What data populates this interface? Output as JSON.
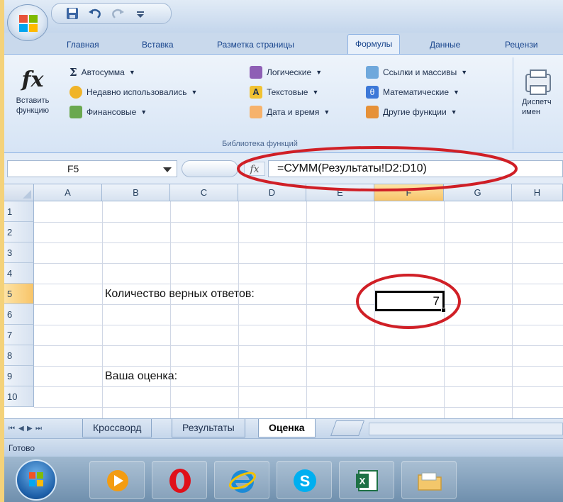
{
  "quick_access": {
    "save_icon": "save-icon",
    "undo_icon": "undo-icon",
    "redo_icon": "redo-icon",
    "customize_icon": "customize-arrow-icon"
  },
  "tabs": [
    "Главная",
    "Вставка",
    "Разметка страницы",
    "Формулы",
    "Данные",
    "Рецензи"
  ],
  "active_tab": "Формулы",
  "ribbon": {
    "insert_function": "Вставить функцию",
    "autosum": "Автосумма",
    "recent": "Недавно использовались",
    "financial": "Финансовые",
    "logical": "Логические",
    "text": "Текстовые",
    "datetime": "Дата и время",
    "lookup": "Ссылки и массивы",
    "math": "Математические",
    "more": "Другие функции",
    "group_label": "Библиотека функций",
    "name_manager": "Диспетч имен"
  },
  "formula_bar": {
    "name_box": "F5",
    "fx": "fx",
    "formula": "=СУММ(Результаты!D2:D10)"
  },
  "columns": [
    "A",
    "B",
    "C",
    "D",
    "E",
    "F",
    "G",
    "H"
  ],
  "rows": [
    "1",
    "2",
    "3",
    "4",
    "5",
    "6",
    "7",
    "8",
    "9",
    "10"
  ],
  "cells": {
    "B5": "Количество верных ответов:",
    "F5": "7",
    "B9": "Ваша оценка:"
  },
  "sheet_nav": [
    "⏮",
    "◀",
    "▶",
    "⏭"
  ],
  "sheets": [
    "Кроссворд",
    "Результаты",
    "Оценка"
  ],
  "active_sheet": "Оценка",
  "status": "Готово",
  "taskbar": [
    "start-orb",
    "media-player",
    "opera",
    "internet-explorer",
    "skype",
    "excel",
    "file-manager"
  ],
  "colors": {
    "annotation": "#d01f26",
    "selection_header": "#f8c468",
    "frame": "#c9d9ec"
  }
}
